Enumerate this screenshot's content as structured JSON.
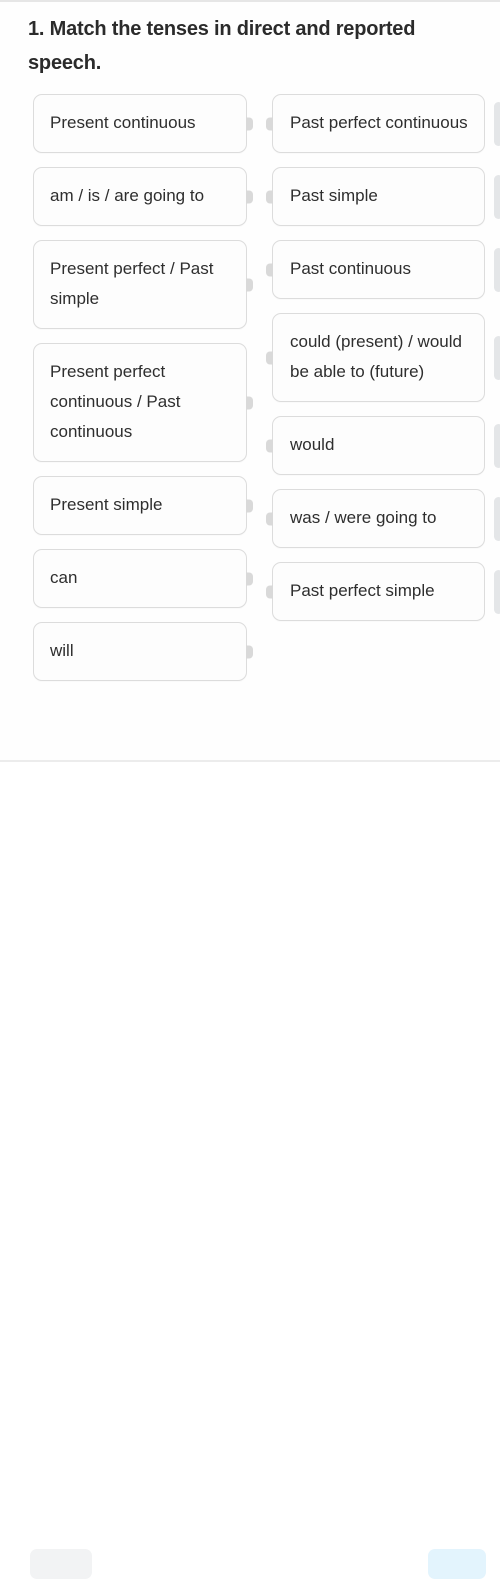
{
  "question": {
    "number": "1.",
    "text": "1. Match the tenses in direct and reported speech."
  },
  "board": {
    "left_column": [
      {
        "label": "Present continuous"
      },
      {
        "label": "am / is / are going to"
      },
      {
        "label": "Present perfect / Past simple"
      },
      {
        "label": "Present perfect continuous / Past continuous"
      },
      {
        "label": "Present simple"
      },
      {
        "label": "can"
      },
      {
        "label": "will"
      }
    ],
    "right_column": [
      {
        "label": "Past perfect continuous"
      },
      {
        "label": "Past simple"
      },
      {
        "label": "Past continuous"
      },
      {
        "label": "could (present) / would be able to (future)"
      },
      {
        "label": "would"
      },
      {
        "label": "was / were going to"
      },
      {
        "label": "Past perfect simple"
      }
    ]
  },
  "footer": {
    "secondary_label": "",
    "primary_label": ""
  },
  "colors": {
    "text": "#2e2e2e",
    "title": "#2b2b2b",
    "card_border": "#dcdcdc",
    "card_background": "#fdfdfd",
    "connector": "#d9d9d9",
    "drag_handle": "#e4e6e8",
    "primary_button": "#e3f4fd",
    "secondary_button": "#f2f3f4"
  }
}
